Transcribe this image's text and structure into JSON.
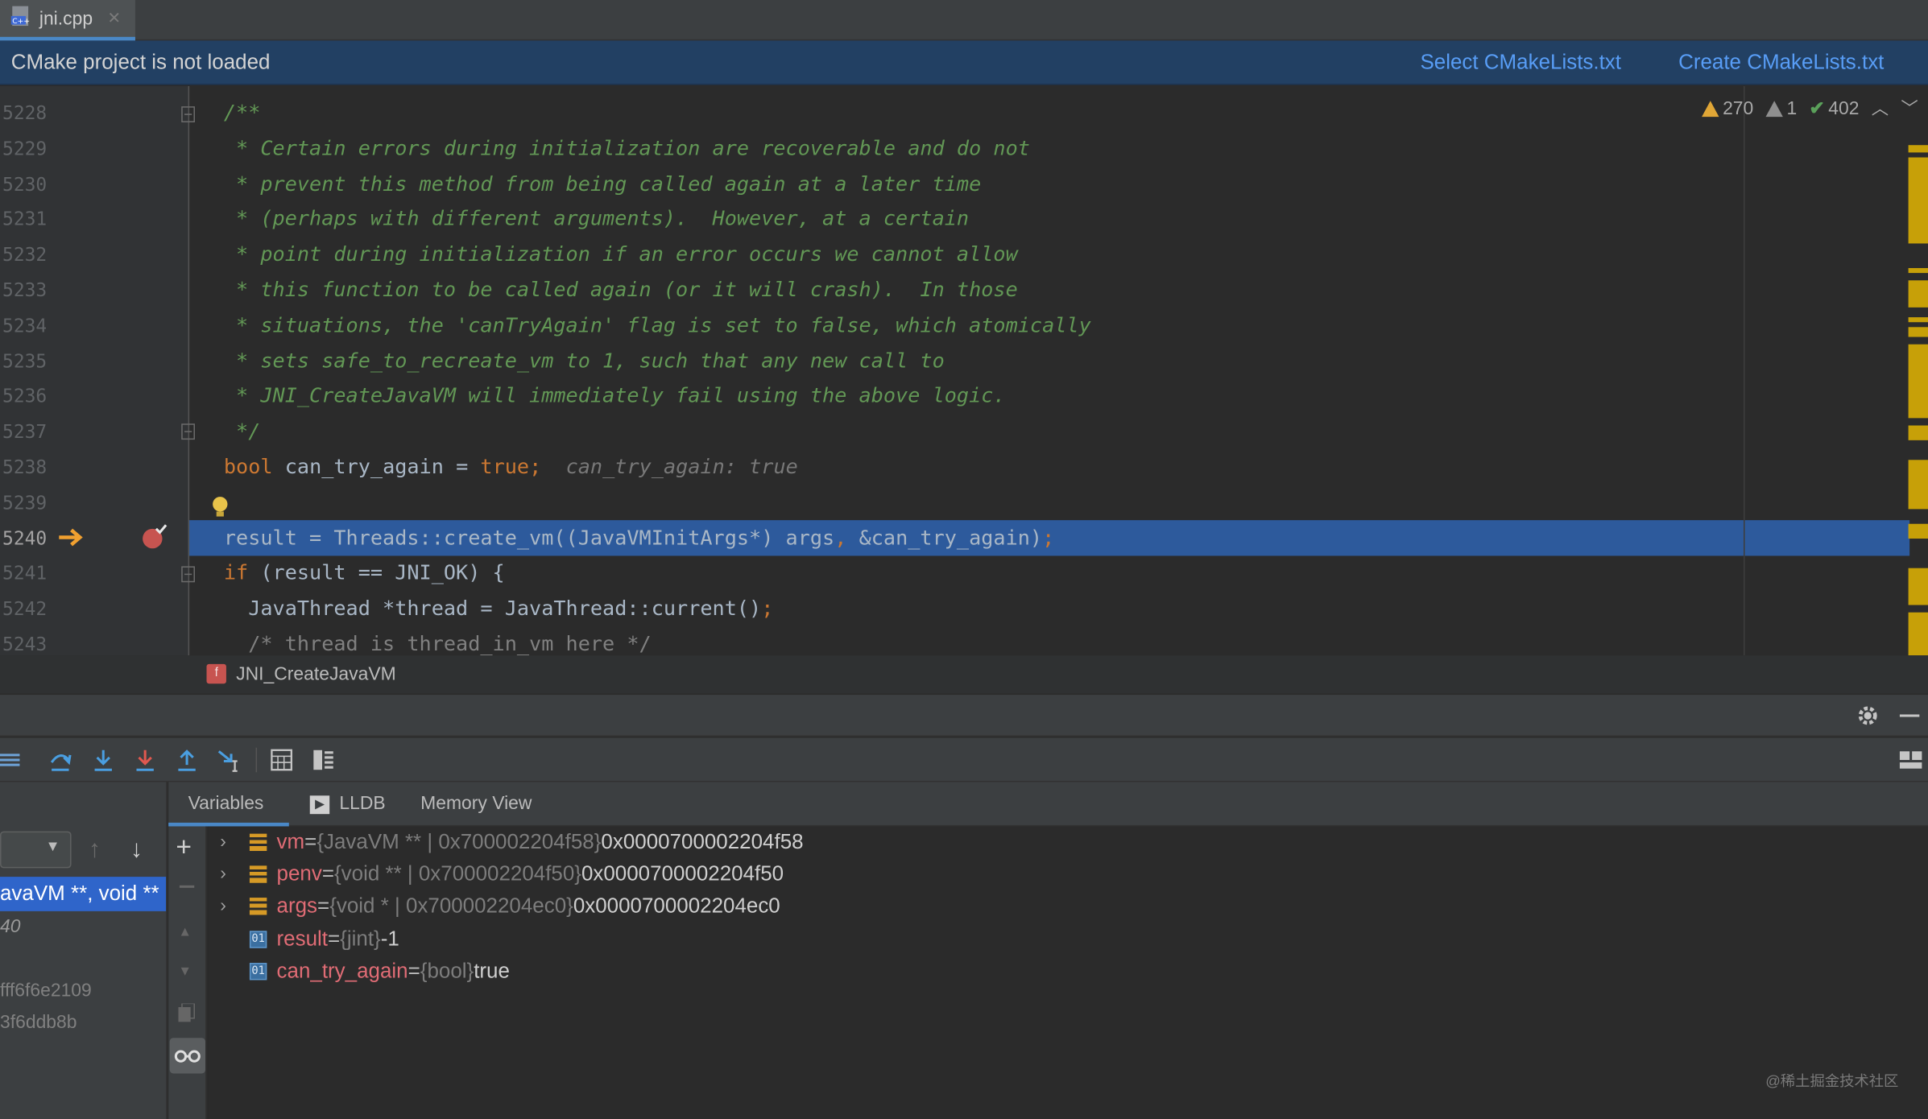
{
  "tab": {
    "filename": "jni.cpp",
    "close": "✕"
  },
  "banner": {
    "message": "CMake project is not loaded",
    "select_link": "Select CMakeLists.txt",
    "create_link": "Create CMakeLists.txt"
  },
  "inspections": {
    "warnings": "270",
    "weak_warnings": "1",
    "ok": "402"
  },
  "lines": [
    {
      "no": "5228",
      "segments": [
        {
          "t": "/**",
          "c": "cmt"
        }
      ]
    },
    {
      "no": "5229",
      "segments": [
        {
          "t": " * Certain errors during initialization are recoverable and do not",
          "c": "cmt"
        }
      ]
    },
    {
      "no": "5230",
      "segments": [
        {
          "t": " * prevent this method from being called again at a later time",
          "c": "cmt"
        }
      ]
    },
    {
      "no": "5231",
      "segments": [
        {
          "t": " * (perhaps with different arguments).  However, at a certain",
          "c": "cmt"
        }
      ]
    },
    {
      "no": "5232",
      "segments": [
        {
          "t": " * point during initialization if an error occurs we cannot allow",
          "c": "cmt"
        }
      ]
    },
    {
      "no": "5233",
      "segments": [
        {
          "t": " * this function to be called again (or it will crash).  In those",
          "c": "cmt"
        }
      ]
    },
    {
      "no": "5234",
      "segments": [
        {
          "t": " * situations, the 'canTryAgain' flag is set to false, which atomically",
          "c": "cmt"
        }
      ]
    },
    {
      "no": "5235",
      "segments": [
        {
          "t": " * sets safe_to_recreate_vm to 1, such that any new call to",
          "c": "cmt"
        }
      ]
    },
    {
      "no": "5236",
      "segments": [
        {
          "t": " * JNI_CreateJavaVM will immediately fail using the above logic.",
          "c": "cmt"
        }
      ]
    },
    {
      "no": "5237",
      "segments": [
        {
          "t": " */",
          "c": "cmt"
        }
      ]
    },
    {
      "no": "5238",
      "segments": [
        {
          "t": "bool",
          "c": "kw"
        },
        {
          "t": " can_try_again = ",
          "c": ""
        },
        {
          "t": "true;",
          "c": "kw"
        },
        {
          "t": "  can_try_again: true",
          "c": "hint"
        }
      ]
    },
    {
      "no": "5239",
      "segments": []
    },
    {
      "no": "5240",
      "segments": [
        {
          "t": "result = Threads::create_vm((JavaVMInitArgs*) args",
          "c": ""
        },
        {
          "t": ",",
          "c": "kw"
        },
        {
          "t": " &can_try_again)",
          "c": ""
        },
        {
          "t": ";",
          "c": "kw"
        }
      ]
    },
    {
      "no": "5241",
      "segments": [
        {
          "t": "if",
          "c": "kw"
        },
        {
          "t": " (result == JNI_OK) {",
          "c": ""
        }
      ]
    },
    {
      "no": "5242",
      "segments": [
        {
          "t": "  JavaThread *thread = JavaThread::current()",
          "c": ""
        },
        {
          "t": ";",
          "c": "kw"
        }
      ]
    },
    {
      "no": "5243",
      "segments": [
        {
          "t": "  /* thread is thread_in_vm here */",
          "c": "gray"
        }
      ]
    }
  ],
  "breadcrumb": {
    "badge": "f",
    "function": "JNI_CreateJavaVM"
  },
  "debug_tabs": [
    {
      "label": "Variables"
    },
    {
      "label": "LLDB"
    },
    {
      "label": "Memory View"
    }
  ],
  "frames": {
    "selected": "avaVM **, void **",
    "rows": [
      "40",
      "fff6f6e2109",
      "3f6ddb8b"
    ]
  },
  "variables": [
    {
      "name": "vm",
      "type": "{JavaVM ** | 0x700002204f58}",
      "value": "0x0000700002204f58",
      "expandable": true,
      "kind": "obj"
    },
    {
      "name": "penv",
      "type": "{void ** | 0x700002204f50}",
      "value": "0x0000700002204f50",
      "expandable": true,
      "kind": "obj"
    },
    {
      "name": "args",
      "type": "{void * | 0x700002204ec0}",
      "value": "0x0000700002204ec0",
      "expandable": true,
      "kind": "obj"
    },
    {
      "name": "result",
      "type": "{jint}",
      "value": "-1",
      "expandable": false,
      "kind": "prim"
    },
    {
      "name": "can_try_again",
      "type": "{bool}",
      "value": "true",
      "expandable": false,
      "kind": "prim"
    }
  ],
  "watermark": "@稀土掘金技术社区"
}
